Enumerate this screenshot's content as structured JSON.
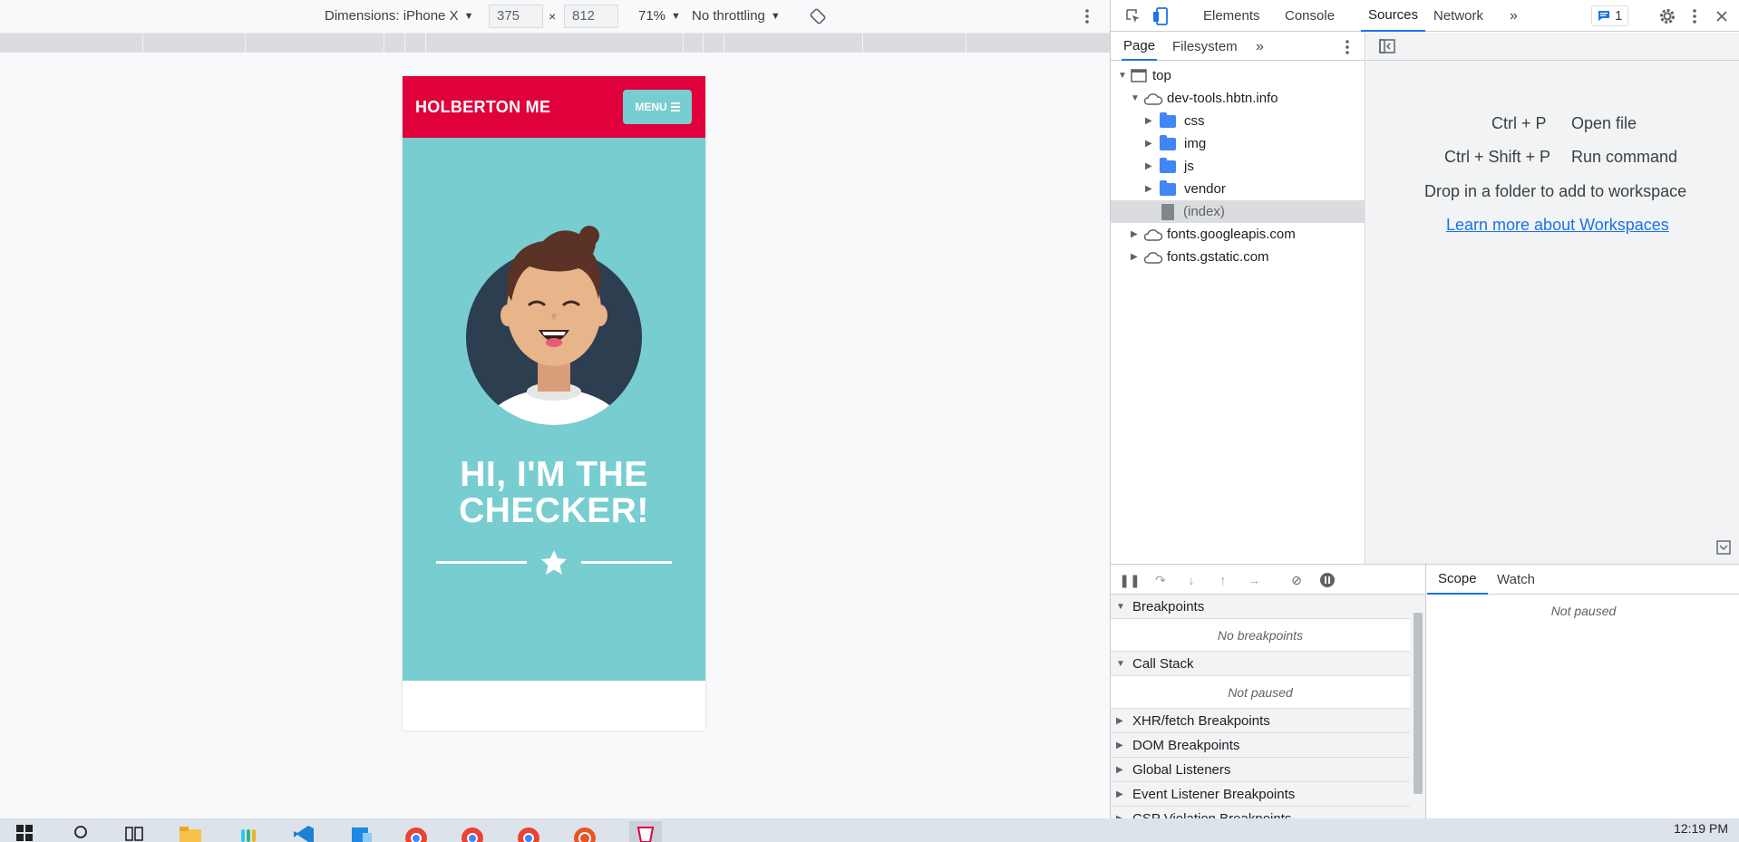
{
  "device_toolbar": {
    "dimensions_label": "Dimensions: iPhone X",
    "width_value": "375",
    "times_sign": "×",
    "height_value": "812",
    "zoom": "71%",
    "throttling": "No throttling"
  },
  "site": {
    "title": "HOLBERTON ME",
    "menu_label": "MENU",
    "heading_line1": "HI, I'M THE",
    "heading_line2": "CHECKER!"
  },
  "devtools": {
    "tabs": [
      "Elements",
      "Console",
      "Sources",
      "Network"
    ],
    "active_tab": "Sources",
    "issues_count": "1",
    "navigator_tabs": [
      "Page",
      "Filesystem"
    ],
    "tree": {
      "top": "top",
      "domain": "dev-tools.hbtn.info",
      "folders": [
        "css",
        "img",
        "js",
        "vendor"
      ],
      "index_file": "(index)",
      "other_domains": [
        "fonts.googleapis.com",
        "fonts.gstatic.com"
      ]
    },
    "shortcuts": {
      "open_file_keys": "Ctrl + P",
      "open_file_label": "Open file",
      "run_command_keys": "Ctrl + Shift + P",
      "run_command_label": "Run command",
      "drop_folder": "Drop in a folder to add to workspace",
      "workspace_link": "Learn more about Workspaces"
    },
    "debugger": {
      "sections": {
        "breakpoints": "Breakpoints",
        "no_breakpoints": "No breakpoints",
        "call_stack": "Call Stack",
        "not_paused": "Not paused",
        "xhr": "XHR/fetch Breakpoints",
        "dom": "DOM Breakpoints",
        "global": "Global Listeners",
        "event": "Event Listener Breakpoints",
        "csp": "CSP Violation Breakpoints"
      },
      "scope_tab": "Scope",
      "watch_tab": "Watch",
      "scope_status": "Not paused"
    }
  },
  "taskbar": {
    "clock": "12:19 PM"
  },
  "colors": {
    "header_red": "#e0003b",
    "hero_teal": "#78cdd1",
    "accent_blue": "#1a73e8"
  }
}
